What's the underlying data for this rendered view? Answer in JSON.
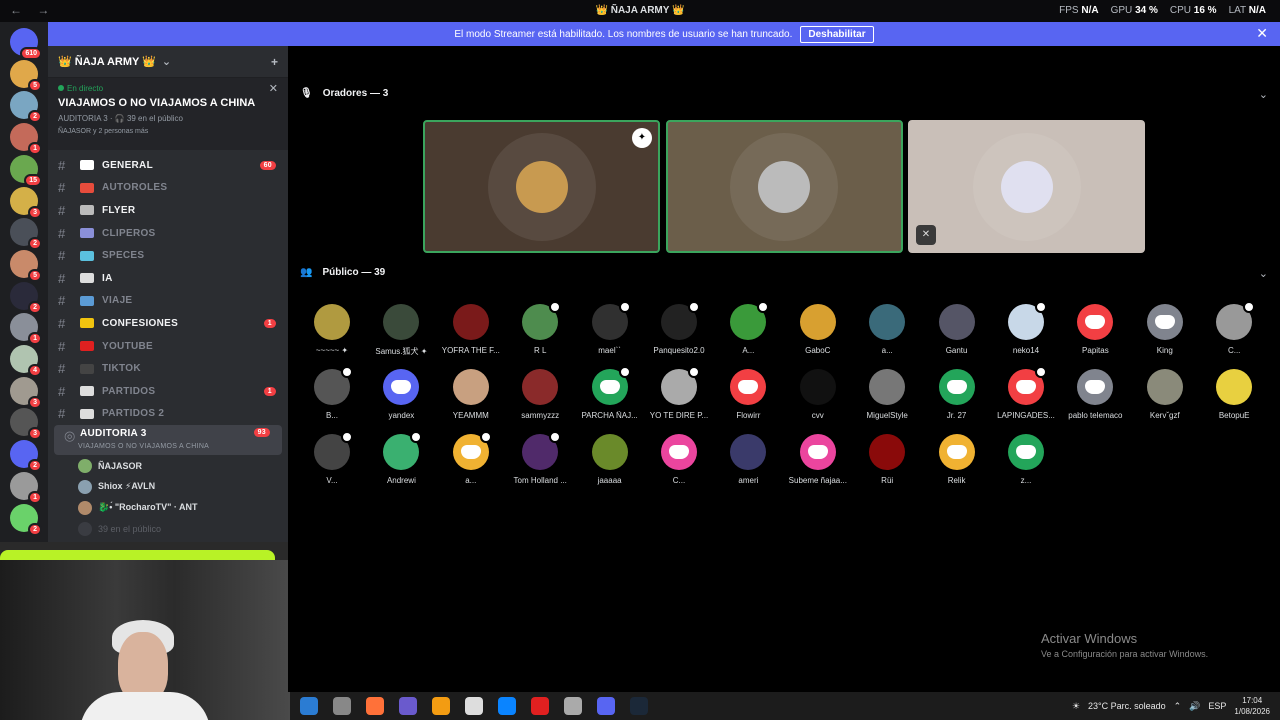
{
  "titlebar": {
    "nav": "← →",
    "title": "👑 ÑAJA ARMY 👑",
    "fps_label": "FPS",
    "fps_value": "N/A",
    "gpu_label": "GPU",
    "gpu_value": "34 %",
    "cpu_label": "CPU",
    "cpu_value": "16 %",
    "lat_label": "LAT",
    "lat_value": "N/A"
  },
  "banner": {
    "text": "El modo Streamer está habilitado. Los nombres de usuario se han truncado.",
    "button": "Deshabilitar",
    "close": "✕"
  },
  "guilds": [
    {
      "badge": "610",
      "color": "#5865f2"
    },
    {
      "badge": "5",
      "color": "#e0a84a"
    },
    {
      "badge": "2",
      "color": "#7aa6c2"
    },
    {
      "badge": "1",
      "color": "#c46a5a"
    },
    {
      "badge": "15",
      "color": "#6aa84f"
    },
    {
      "badge": "3",
      "color": "#d4b048"
    },
    {
      "badge": "2",
      "color": "#4a4f58"
    },
    {
      "badge": "5",
      "color": "#c98a6a"
    },
    {
      "badge": "2",
      "color": "#2a2a3a"
    },
    {
      "badge": "1",
      "color": "#8a8f99"
    },
    {
      "badge": "4",
      "color": "#b0c4b0"
    },
    {
      "badge": "3",
      "color": "#a09a90"
    },
    {
      "badge": "3",
      "color": "#555"
    },
    {
      "badge": "2",
      "color": "#5865f2"
    },
    {
      "badge": "1",
      "color": "#9a9a9a"
    },
    {
      "badge": "2",
      "color": "#6ad26a"
    }
  ],
  "server": {
    "name": "👑 ÑAJA ARMY 👑",
    "chevron": "⌄",
    "add_icon": "+"
  },
  "live": {
    "tag": "En directo",
    "title": "VIAJAMOS O NO VIAJAMOS A CHINA",
    "meta": "AUDITORIA 3 · 🎧 39 en el público",
    "people": "ÑAJASOR y 2 personas más",
    "close": "✕"
  },
  "channels": [
    {
      "name": "GENERAL",
      "bright": true,
      "count": "60",
      "color": "#fff"
    },
    {
      "name": "AUTOROLES",
      "bright": false,
      "count": "",
      "color": "#e74c3c"
    },
    {
      "name": "FLYER",
      "bright": true,
      "count": "",
      "color": "#bbb"
    },
    {
      "name": "CLIPEROS",
      "bright": false,
      "count": "",
      "color": "#8a8fd8"
    },
    {
      "name": "SPECES",
      "bright": false,
      "count": "",
      "color": "#5bc0de"
    },
    {
      "name": "IA",
      "bright": true,
      "count": "",
      "color": "#ddd"
    },
    {
      "name": "VIAJE",
      "bright": false,
      "count": "",
      "color": "#5b9bd5"
    },
    {
      "name": "CONFESIONES",
      "bright": true,
      "count": "1",
      "color": "#f1c40f"
    },
    {
      "name": "YOUTUBE",
      "bright": false,
      "count": "",
      "color": "#e02020"
    },
    {
      "name": "TIKTOK",
      "bright": false,
      "count": "",
      "color": "#444"
    },
    {
      "name": "PARTIDOS",
      "bright": false,
      "count": "1",
      "color": "#ddd"
    },
    {
      "name": "PARTIDOS 2",
      "bright": false,
      "count": "",
      "color": "#ddd"
    }
  ],
  "active_channel": {
    "name": "AUDITORIA 3",
    "count": "93",
    "sub": "VIAJAMOS O NO VIAJAMOS A CHINA"
  },
  "members": [
    {
      "name": "ÑAJASOR",
      "color": "#7fae6a"
    },
    {
      "name": "Shiox ⚡AVLN",
      "color": "#8aa0b0"
    },
    {
      "name": "🐉•́ \"RocharoTV\" · ANT",
      "color": "#b08a6a"
    }
  ],
  "member_dim": "39 en el público",
  "stage": {
    "speakers_title": "Oradores — 3",
    "audience_title": "Público — 39",
    "chevron": "⌄"
  },
  "speakers": [
    {
      "bg": "#4a3b30",
      "border": "#3ba55d",
      "pic": "#c89a50"
    },
    {
      "bg": "#6b5e4a",
      "border": "#3ba55d",
      "pic": "#bbbbbb"
    },
    {
      "bg": "#c9bfb8",
      "border": "none",
      "pic": "#e0e0f0"
    }
  ],
  "audience": [
    {
      "name": "~~~~~ ✦",
      "color": "#b09a40",
      "discord": false,
      "hand": false
    },
    {
      "name": "Samus.狐犬 ✦",
      "color": "#3a4a3a",
      "discord": false,
      "hand": false
    },
    {
      "name": "YOFRA THE F...",
      "color": "#7a1a1a",
      "discord": false,
      "hand": false
    },
    {
      "name": "R L",
      "color": "#4e8c4e",
      "discord": false,
      "hand": true
    },
    {
      "name": "maelˋˋ",
      "color": "#303030",
      "discord": false,
      "hand": true
    },
    {
      "name": "Panquesito2.0",
      "color": "#222",
      "discord": false,
      "hand": true
    },
    {
      "name": "A...",
      "color": "#3a9a3a",
      "discord": false,
      "hand": true
    },
    {
      "name": "GaboC",
      "color": "#d8a030",
      "discord": false,
      "hand": false
    },
    {
      "name": "a...",
      "color": "#3a6a7a",
      "discord": false,
      "hand": false
    },
    {
      "name": "Gantu",
      "color": "#556",
      "discord": false,
      "hand": false
    },
    {
      "name": "neko14",
      "color": "#c8d8e8",
      "discord": false,
      "hand": true
    },
    {
      "name": "Papitas",
      "color": "#f23f43",
      "discord": true,
      "hand": false
    },
    {
      "name": "King",
      "color": "#80848e",
      "discord": true,
      "hand": false
    },
    {
      "name": "C...",
      "color": "#999",
      "discord": false,
      "hand": true
    },
    {
      "name": "B...",
      "color": "#555",
      "discord": false,
      "hand": true
    },
    {
      "name": "yandex",
      "color": "#5865f2",
      "discord": true,
      "hand": false
    },
    {
      "name": "YEAMMM",
      "color": "#c8a080",
      "discord": false,
      "hand": false
    },
    {
      "name": "sammyzzz",
      "color": "#8a2a2a",
      "discord": false,
      "hand": false
    },
    {
      "name": "PARCHA ÑAJ...",
      "color": "#23a55a",
      "discord": true,
      "hand": true
    },
    {
      "name": "YO TE DIRE P...",
      "color": "#aaa",
      "discord": false,
      "hand": true
    },
    {
      "name": "Flowirr",
      "color": "#f23f43",
      "discord": true,
      "hand": false
    },
    {
      "name": "cvv",
      "color": "#111",
      "discord": false,
      "hand": false
    },
    {
      "name": "MiguelStyle",
      "color": "#777",
      "discord": false,
      "hand": false
    },
    {
      "name": "Jr. 27",
      "color": "#23a55a",
      "discord": true,
      "hand": false
    },
    {
      "name": "LAPINGADES...",
      "color": "#f23f43",
      "discord": true,
      "hand": true
    },
    {
      "name": "pablo telemaco",
      "color": "#80848e",
      "discord": true,
      "hand": false
    },
    {
      "name": "Kervˇgzf",
      "color": "#8a8a7a",
      "discord": false,
      "hand": false
    },
    {
      "name": "BetopuE",
      "color": "#e8d040",
      "discord": false,
      "hand": false
    },
    {
      "name": "V...",
      "color": "#444",
      "discord": false,
      "hand": true
    },
    {
      "name": "Andrewi",
      "color": "#3ab070",
      "discord": false,
      "hand": true
    },
    {
      "name": "a...",
      "color": "#f0b232",
      "discord": true,
      "hand": true
    },
    {
      "name": "Tom Holland ...",
      "color": "#502a6a",
      "discord": false,
      "hand": true
    },
    {
      "name": "jaaaaa",
      "color": "#6a8a2a",
      "discord": false,
      "hand": false
    },
    {
      "name": "C...",
      "color": "#eb459e",
      "discord": true,
      "hand": false
    },
    {
      "name": "ameri",
      "color": "#3a3a6a",
      "discord": false,
      "hand": false
    },
    {
      "name": "Subeme ñajaa...",
      "color": "#eb459e",
      "discord": true,
      "hand": false
    },
    {
      "name": "Rüi",
      "color": "#8a0a0a",
      "discord": false,
      "hand": false
    },
    {
      "name": "Relik",
      "color": "#f0b232",
      "discord": true,
      "hand": false
    },
    {
      "name": "z...",
      "color": "#23a55a",
      "discord": true,
      "hand": false
    }
  ],
  "watermark": {
    "title": "Activar Windows",
    "sub": "Ve a Configuración para activar Windows."
  },
  "taskbar": {
    "apps": [
      "#2b7cd3",
      "#888",
      "#ff7139",
      "#6a5acd",
      "#f39c12",
      "#ddd",
      "#0a84ff",
      "#e02020",
      "#aaa",
      "#5865f2",
      "#1b2838"
    ],
    "weather": "23°C  Parc. soleado",
    "lang": "ESP",
    "time": "17:04",
    "date": "1/08/2026"
  }
}
